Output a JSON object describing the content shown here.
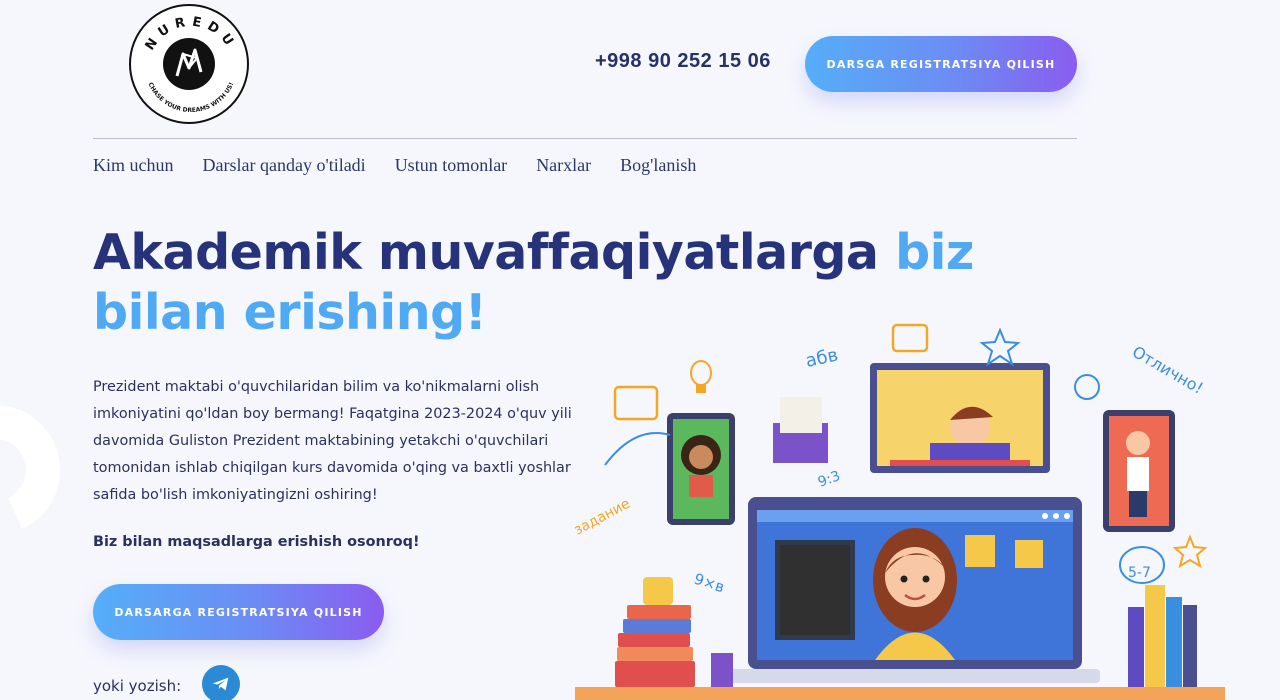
{
  "logo": {
    "brand": "NUREDU",
    "slogan": "CHASE YOUR DREAMS WITH US!"
  },
  "header": {
    "phone": "+998 90 252 15 06",
    "cta_label": "DARSGA REGISTRATSIYA QILISH"
  },
  "nav": {
    "items": [
      "Kim uchun",
      "Darslar qanday o'tiladi",
      "Ustun tomonlar",
      "Narxlar",
      "Bog'lanish"
    ]
  },
  "hero": {
    "title_part1": "Akademik muvaffaqiyatlarga ",
    "title_part2": "biz bilan erishing!",
    "description": "Prezident maktabi o'quvchilaridan bilim va ko'nikmalarni olish imkoniyatini qo'ldan boy bermang! Faqatgina 2023-2024 o'quv yili davomida Guliston Prezident maktabining yetakchi o'quvchilari tomonidan ishlab chiqilgan kurs davomida o'qing va baxtli yoshlar safida bo'lish imkoniyatingizni oshiring!",
    "tagline": "Biz bilan maqsadlarga erishish osonroq!",
    "cta_label": "DARSARGA REGISTRATSIYA QILISH",
    "contact_label": "yoki yozish:"
  },
  "illustration": {
    "doodles": [
      "абв",
      "Отлично!",
      "задание",
      "9×в",
      "9:3",
      "5-7"
    ]
  },
  "colors": {
    "dark": "#26327a",
    "accent": "#4fa9f3",
    "button_start": "#55aef8",
    "button_end": "#8a5cf0"
  }
}
